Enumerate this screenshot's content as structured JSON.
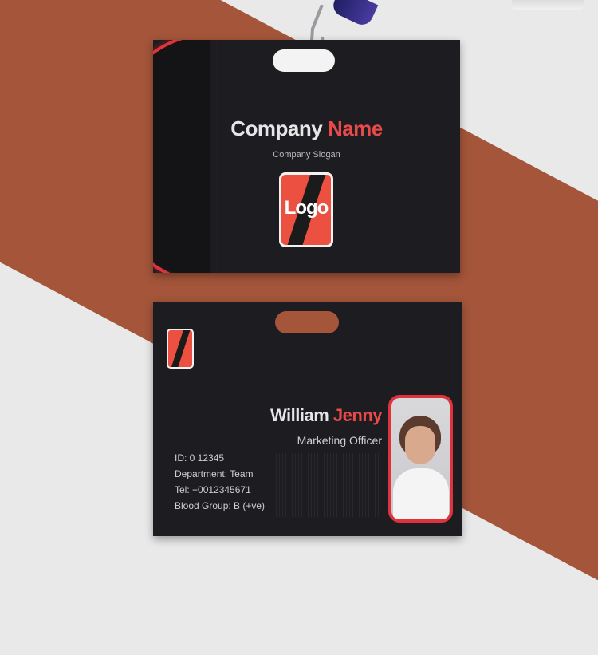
{
  "front_card": {
    "company_name_part1": "Company",
    "company_name_part2": "Name",
    "slogan": "Company Slogan",
    "logo_text": "Logo"
  },
  "back_card": {
    "first_name": "William",
    "last_name": "Jenny",
    "job_title": "Marketing Officer",
    "info_lines": [
      "ID: 0 12345",
      "Department: Team",
      "Tel: +0012345671",
      "Blood Group: B (+ve)"
    ]
  },
  "colors": {
    "accent": "#e84a4a",
    "card_background": "#1d1c20",
    "page_band": "#a4553a"
  }
}
